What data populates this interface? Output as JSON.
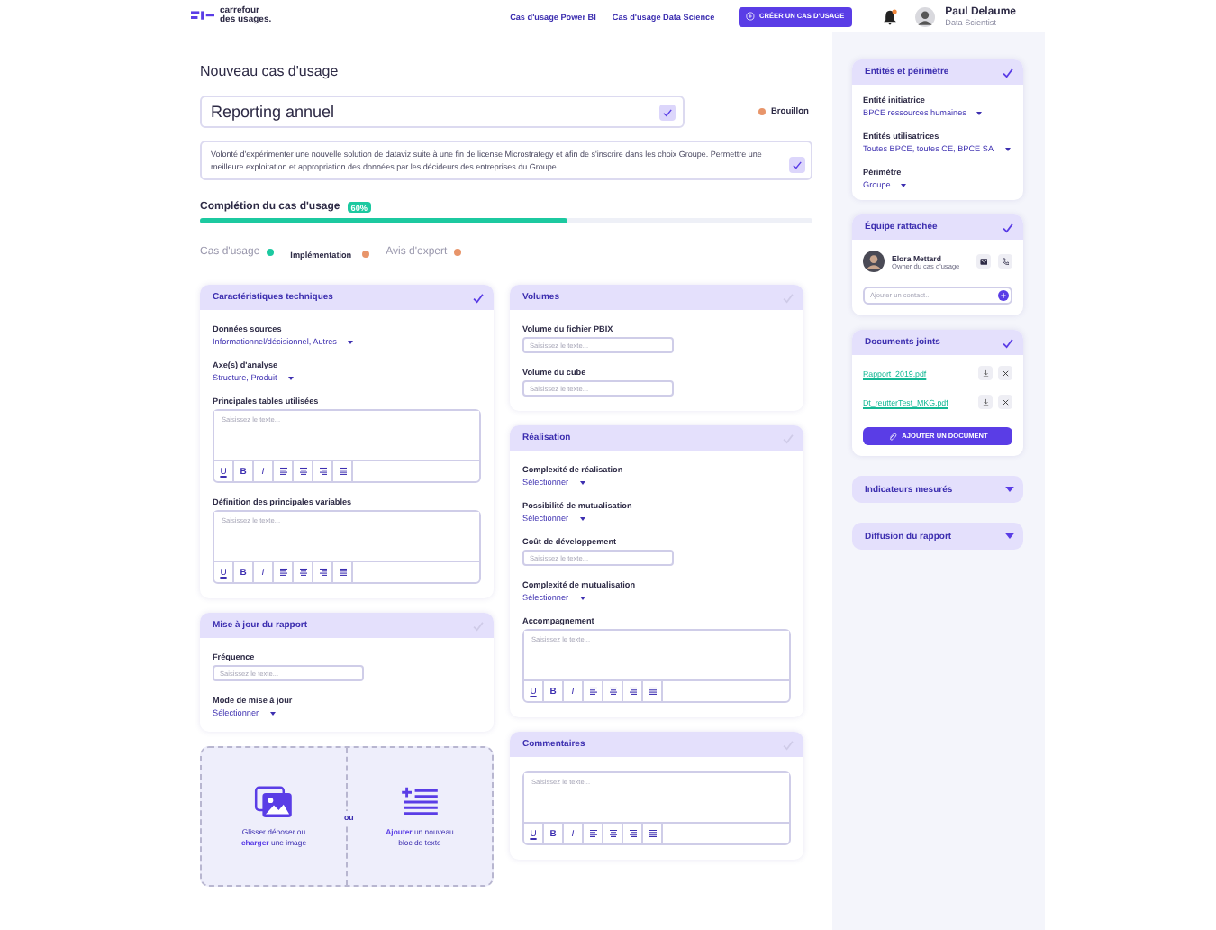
{
  "header": {
    "logo_line1": "carrefour",
    "logo_line2": "des usages.",
    "nav": [
      {
        "label": "Cas d'usage Power BI"
      },
      {
        "label": "Cas d'usage Data Science"
      }
    ],
    "create_button": "CRÉER UN CAS D'USAGE",
    "unread": true,
    "user": {
      "name": "Paul Delaume",
      "role": "Data Scientist"
    }
  },
  "page_title": "Nouveau cas d'usage",
  "title_field": {
    "value": "Reporting annuel",
    "validated": true
  },
  "status": {
    "label": "Brouillon",
    "color": "#e8956a"
  },
  "description": {
    "value": "Volonté d'expérimenter une nouvelle solution de dataviz suite à une fin de license Microstrategy et afin de s'inscrire dans les choix Groupe. Permettre une meilleure exploitation et appropriation des données par les décideurs des entreprises du Groupe.",
    "validated": true
  },
  "completion": {
    "label": "Complétion du cas d'usage",
    "badge": "60%",
    "level": 0.6
  },
  "tabs": [
    {
      "label": "Cas d'usage",
      "selected": false,
      "color": "#1cc9a0"
    },
    {
      "label": "Implémentation",
      "selected": true,
      "color": "#e8956a"
    },
    {
      "label": "Avis d'expert",
      "selected": false,
      "color": "#e8956a"
    }
  ],
  "columns": [
    [
      {
        "title": "Caractéristiques techniques",
        "validated": true,
        "fields": [
          {
            "kind": "select",
            "label": "Données sources",
            "value": "Informationnel/décisionnel, Autres"
          },
          {
            "kind": "select",
            "label": "Axe(s) d'analyse",
            "value": "Structure, Produit"
          },
          {
            "kind": "editor",
            "label": "Principales tables utilisées",
            "placeholder": "Saisissez le texte...",
            "toolbar": [
              "U",
              "B",
              "I"
            ]
          },
          {
            "kind": "editor",
            "label": "Définition des principales variables",
            "placeholder": "Saisissez le texte...",
            "toolbar": [
              "U",
              "B",
              "I"
            ]
          }
        ]
      },
      {
        "title": "Mise à jour du rapport",
        "validated": false,
        "fields": [
          {
            "kind": "text",
            "label": "Fréquence",
            "placeholder": "Saisissez le texte..."
          },
          {
            "kind": "select",
            "label": "Mode de mise à jour",
            "value": "Sélectionner"
          }
        ]
      }
    ],
    [
      {
        "title": "Volumes",
        "validated": false,
        "fields": [
          {
            "kind": "text",
            "label": "Volume du fichier PBIX",
            "placeholder": "Saisissez le texte..."
          },
          {
            "kind": "text",
            "label": "Volume du cube",
            "placeholder": "Saisissez le texte..."
          }
        ]
      },
      {
        "title": "Réalisation",
        "validated": false,
        "fields": [
          {
            "kind": "select",
            "label": "Complexité de réalisation",
            "value": "Sélectionner"
          },
          {
            "kind": "select",
            "label": "Possibilité de mutualisation",
            "value": "Sélectionner"
          },
          {
            "kind": "text",
            "label": "Coût de développement",
            "placeholder": "Saisissez le texte..."
          },
          {
            "kind": "select",
            "label": "Complexité de mutualisation",
            "value": "Sélectionner"
          },
          {
            "kind": "editor",
            "label": "Accompagnement",
            "placeholder": "Saisissez le texte...",
            "toolbar": [
              "U",
              "B",
              "I"
            ]
          }
        ]
      },
      {
        "title": "Commentaires",
        "validated": false,
        "fields": [
          {
            "kind": "editor",
            "placeholder": "Saisissez le texte...",
            "toolbar": [
              "U",
              "B",
              "I"
            ]
          }
        ]
      }
    ]
  ],
  "drop_zone": {
    "image_text": "Glisser déposer ou **charger** une image",
    "separator": "ou",
    "text_block": "**Ajouter** un nouveau bloc de texte"
  },
  "sidebar": [
    {
      "kind": "panel",
      "title": "Entités et périmètre",
      "validated": true,
      "fields": [
        {
          "kind": "select",
          "label": "Entité initiatrice",
          "value": "BPCE ressources humaines"
        },
        {
          "kind": "select",
          "label": "Entités utilisatrices",
          "value": "Toutes BPCE, toutes CE, BPCE SA"
        },
        {
          "kind": "select",
          "label": "Périmètre",
          "value": "Groupe"
        }
      ]
    },
    {
      "kind": "panel",
      "title": "Équipe rattachée",
      "validated": true,
      "fields": [
        {
          "kind": "member",
          "name": "Elora Mettard",
          "role": "Owner du cas d'usage"
        },
        {
          "kind": "contact",
          "placeholder": "Ajouter un contact..."
        }
      ]
    },
    {
      "kind": "panel",
      "title": "Documents joints",
      "validated": true,
      "fields": [
        {
          "kind": "document",
          "name": "Rapport_2019.pdf"
        },
        {
          "kind": "document",
          "name": "Dt_reutterTest_MKG.pdf"
        },
        {
          "kind": "button",
          "label": "AJOUTER UN DOCUMENT"
        }
      ]
    },
    {
      "kind": "collapsed",
      "title": "Indicateurs mesurés"
    },
    {
      "kind": "collapsed",
      "title": "Diffusion du rapport"
    }
  ]
}
